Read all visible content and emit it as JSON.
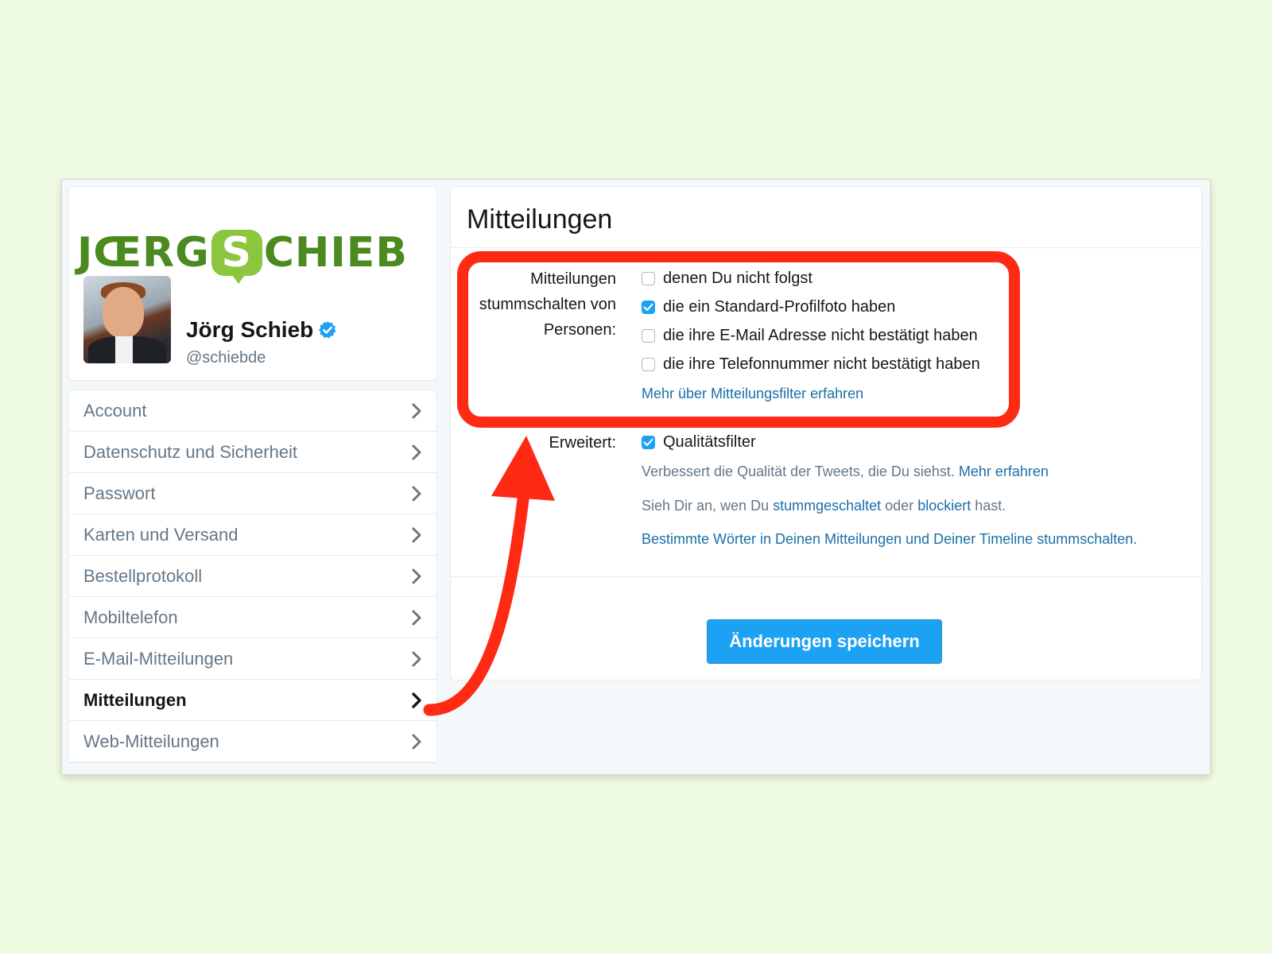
{
  "branding": {
    "logo_left": "JŒRG",
    "logo_bubble": "S",
    "logo_right": "CHIEB"
  },
  "profile": {
    "name": "Jörg Schieb",
    "handle": "@schiebde"
  },
  "nav": {
    "items": [
      {
        "label": "Account"
      },
      {
        "label": "Datenschutz und Sicherheit"
      },
      {
        "label": "Passwort"
      },
      {
        "label": "Karten und Versand"
      },
      {
        "label": "Bestellprotokoll"
      },
      {
        "label": "Mobiltelefon"
      },
      {
        "label": "E-Mail-Mitteilungen"
      },
      {
        "label": "Mitteilungen",
        "active": true
      },
      {
        "label": "Web-Mitteilungen"
      }
    ]
  },
  "panel": {
    "title": "Mitteilungen",
    "mute": {
      "label_line1": "Mitteilungen",
      "label_line2": "stummschalten von",
      "label_line3": "Personen:",
      "options": [
        {
          "label": "denen Du nicht folgst",
          "checked": false
        },
        {
          "label": "die ein Standard-Profilfoto haben",
          "checked": true
        },
        {
          "label": "die ihre E-Mail Adresse nicht bestätigt haben",
          "checked": false
        },
        {
          "label": "die ihre Telefonnummer nicht bestätigt haben",
          "checked": false
        }
      ],
      "link": "Mehr über Mitteilungsfilter erfahren"
    },
    "advanced": {
      "label": "Erweitert:",
      "quality_filter": {
        "label": "Qualitätsfilter",
        "checked": true
      },
      "description": "Verbessert die Qualität der Tweets, die Du siehst.",
      "description_link": "Mehr erfahren",
      "muted_text_1": "Sieh Dir an, wen Du",
      "muted_link": "stummgeschaltet",
      "muted_text_2": "oder",
      "blocked_link": "blockiert",
      "muted_text_3": "hast.",
      "words_link": "Bestimmte Wörter in Deinen Mitteilungen und Deiner Timeline stummschalten."
    },
    "save_label": "Änderungen speichern"
  },
  "colors": {
    "page_background": "#f0fbe3",
    "annotation_red": "#ff2a14",
    "button_blue": "#1da1f2",
    "link_blue": "#1b6ea8",
    "logo_green": "#4a8a1e"
  }
}
